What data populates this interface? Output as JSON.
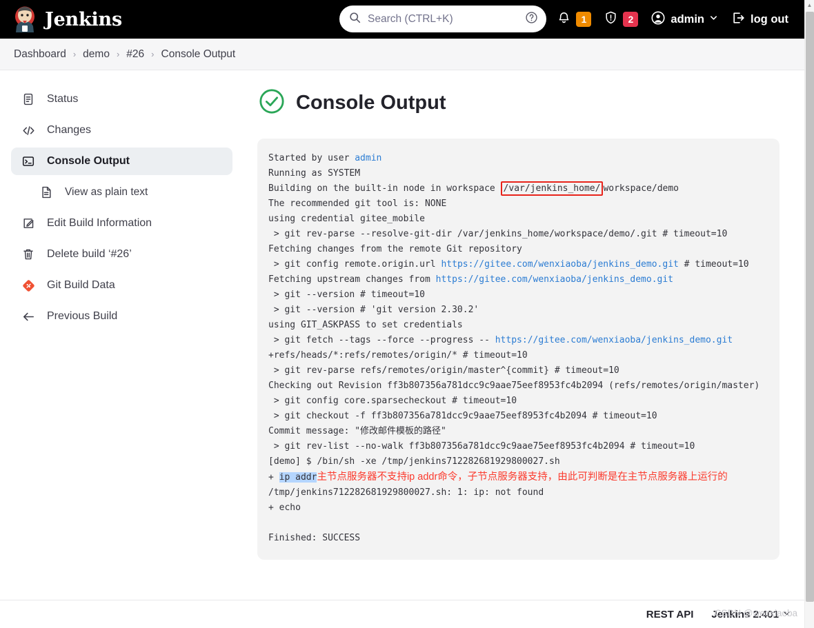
{
  "header": {
    "brand": "Jenkins",
    "logo_icon": "jenkins-butler-logo",
    "search": {
      "icon": "search-icon",
      "placeholder": "Search (CTRL+K)",
      "value": "",
      "help_icon": "help-circle-icon"
    },
    "notifications": {
      "icon": "bell-icon",
      "count": "1",
      "color": "#f08b00"
    },
    "security": {
      "icon": "shield-exclamation-icon",
      "count": "2",
      "color": "#e5334e"
    },
    "user": {
      "icon": "user-circle-icon",
      "label": "admin",
      "chevron_icon": "chevron-down-icon"
    },
    "logout": {
      "icon": "logout-icon",
      "label": "log out"
    }
  },
  "breadcrumb": {
    "separator": "›",
    "items": [
      {
        "label": "Dashboard"
      },
      {
        "label": "demo"
      },
      {
        "label": "#26"
      },
      {
        "label": "Console Output"
      }
    ]
  },
  "sidebar": {
    "items": [
      {
        "label": "Status",
        "icon": "document-status-icon",
        "active": false,
        "sub": false
      },
      {
        "label": "Changes",
        "icon": "code-brackets-icon",
        "active": false,
        "sub": false
      },
      {
        "label": "Console Output",
        "icon": "terminal-icon",
        "active": true,
        "sub": false
      },
      {
        "label": "View as plain text",
        "icon": "plain-text-file-icon",
        "active": false,
        "sub": true
      },
      {
        "label": "Edit Build Information",
        "icon": "edit-pencil-icon",
        "active": false,
        "sub": false
      },
      {
        "label": "Delete build ‘#26’",
        "icon": "trash-icon",
        "active": false,
        "sub": false
      },
      {
        "label": "Git Build Data",
        "icon": "git-diamond-icon",
        "active": false,
        "sub": false
      },
      {
        "label": "Previous Build",
        "icon": "arrow-left-icon",
        "active": false,
        "sub": false
      }
    ]
  },
  "main": {
    "status_icon": "check-circle-icon",
    "status_color": "#2aa657",
    "title": "Console Output"
  },
  "console": {
    "lines": [
      [
        {
          "t": "Started by user "
        },
        {
          "t": "admin",
          "s": "link"
        }
      ],
      [
        {
          "t": "Running as SYSTEM"
        }
      ],
      [
        {
          "t": "Building on the built-in node in workspace "
        },
        {
          "t": "/var/jenkins_home/",
          "s": "boxed"
        },
        {
          "t": "workspace/demo"
        }
      ],
      [
        {
          "t": "The recommended git tool is: NONE"
        }
      ],
      [
        {
          "t": "using credential gitee_mobile"
        }
      ],
      [
        {
          "t": " > git rev-parse --resolve-git-dir /var/jenkins_home/workspace/demo/.git # timeout=10"
        }
      ],
      [
        {
          "t": "Fetching changes from the remote Git repository"
        }
      ],
      [
        {
          "t": " > git config remote.origin.url "
        },
        {
          "t": "https://gitee.com/wenxiaoba/jenkins_demo.git",
          "s": "link"
        },
        {
          "t": " # timeout=10"
        }
      ],
      [
        {
          "t": "Fetching upstream changes from "
        },
        {
          "t": "https://gitee.com/wenxiaoba/jenkins_demo.git",
          "s": "link"
        }
      ],
      [
        {
          "t": " > git --version # timeout=10"
        }
      ],
      [
        {
          "t": " > git --version # 'git version 2.30.2'"
        }
      ],
      [
        {
          "t": "using GIT_ASKPASS to set credentials"
        }
      ],
      [
        {
          "t": " > git fetch --tags --force --progress -- "
        },
        {
          "t": "https://gitee.com/wenxiaoba/jenkins_demo.git",
          "s": "link"
        }
      ],
      [
        {
          "t": "+refs/heads/*:refs/remotes/origin/* # timeout=10"
        }
      ],
      [
        {
          "t": " > git rev-parse refs/remotes/origin/master^{commit} # timeout=10"
        }
      ],
      [
        {
          "t": "Checking out Revision ff3b807356a781dcc9c9aae75eef8953fc4b2094 (refs/remotes/origin/master)"
        }
      ],
      [
        {
          "t": " > git config core.sparsecheckout # timeout=10"
        }
      ],
      [
        {
          "t": " > git checkout -f ff3b807356a781dcc9c9aae75eef8953fc4b2094 # timeout=10"
        }
      ],
      [
        {
          "t": "Commit message: \"修改邮件模板的路径\""
        }
      ],
      [
        {
          "t": " > git rev-list --no-walk ff3b807356a781dcc9c9aae75eef8953fc4b2094 # timeout=10"
        }
      ],
      [
        {
          "t": "[demo] $ /bin/sh -xe /tmp/jenkins712282681929800027.sh"
        }
      ],
      [
        {
          "t": "+ "
        },
        {
          "t": "ip addr",
          "s": "selected"
        },
        {
          "t": "主节点服务器不支持ip addr命令，子节点服务器支持，由此可判断是在主节点服务器上运行的",
          "s": "note"
        }
      ],
      [
        {
          "t": "/tmp/jenkins712282681929800027.sh: 1: ip: not found"
        }
      ],
      [
        {
          "t": "+ echo"
        }
      ],
      [
        {
          "t": ""
        }
      ],
      [
        {
          "t": "Finished: SUCCESS"
        }
      ]
    ]
  },
  "footer": {
    "rest_api": "REST API",
    "version": "Jenkins 2.401",
    "version_chevron_icon": "chevron-down-icon",
    "watermark": "CSDN @wenxiaoba"
  }
}
